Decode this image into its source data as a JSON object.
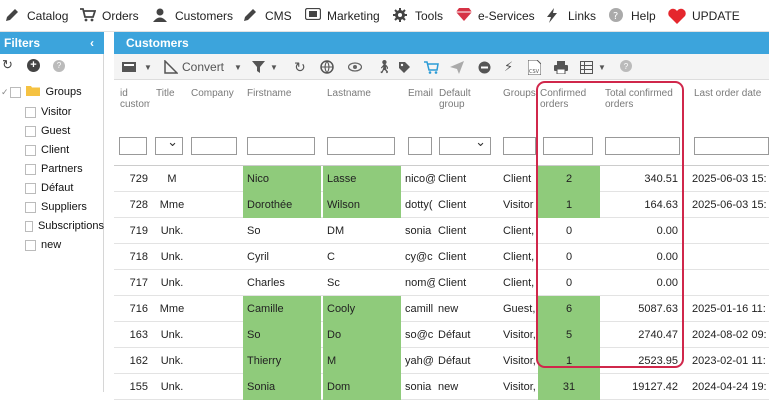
{
  "menu": [
    {
      "label": "Catalog",
      "icon": "pencil-icon"
    },
    {
      "label": "Orders",
      "icon": "cart-icon"
    },
    {
      "label": "Customers",
      "icon": "user-icon"
    },
    {
      "label": "CMS",
      "icon": "pencil-icon"
    },
    {
      "label": "Marketing",
      "icon": "ticket-icon"
    },
    {
      "label": "Tools",
      "icon": "gear-icon"
    },
    {
      "label": "e-Services",
      "icon": "diamond-icon"
    },
    {
      "label": "Links",
      "icon": "bolt-icon"
    },
    {
      "label": "Help",
      "icon": "help-icon"
    },
    {
      "label": "UPDATE",
      "icon": "heart-icon"
    }
  ],
  "filters": {
    "title": "Filters",
    "collapse_icon": "chevron-left-icon",
    "tree_root": "Groups",
    "groups": [
      "Visitor",
      "Guest",
      "Client",
      "Partners",
      "Défaut",
      "Suppliers",
      "Subscriptions",
      "new"
    ]
  },
  "grid": {
    "title": "Customers",
    "toolbar": {
      "convert_label": "Convert"
    },
    "columns": [
      {
        "key": "id",
        "label": "id custom"
      },
      {
        "key": "title",
        "label": "Title"
      },
      {
        "key": "company",
        "label": "Company"
      },
      {
        "key": "firstname",
        "label": "Firstname"
      },
      {
        "key": "lastname",
        "label": "Lastname"
      },
      {
        "key": "email",
        "label": "Email"
      },
      {
        "key": "default_group",
        "label": "Default group"
      },
      {
        "key": "groups",
        "label": "Groups"
      },
      {
        "key": "confirmed_orders",
        "label": "Confirmed orders"
      },
      {
        "key": "total_confirmed_orders",
        "label": "Total confirmed orders"
      },
      {
        "key": "last_order_date",
        "label": "Last order date"
      }
    ],
    "rows": [
      {
        "id": "729",
        "title": "M",
        "company": "",
        "firstname": "Nico",
        "lastname": "Lasse",
        "email": "nico@",
        "default_group": "Client",
        "groups": "Client",
        "confirmed_orders": "2",
        "total": "340.51",
        "last_order": "2025-06-03 15:",
        "hl_name": true,
        "hl_orders": true
      },
      {
        "id": "728",
        "title": "Mme",
        "company": "",
        "firstname": "Dorothée",
        "lastname": "Wilson",
        "email": "dotty(",
        "default_group": "Client",
        "groups": "Visitor",
        "confirmed_orders": "1",
        "total": "164.63",
        "last_order": "2025-06-03 15:",
        "hl_name": true,
        "hl_orders": true
      },
      {
        "id": "719",
        "title": "Unk.",
        "company": "",
        "firstname": "So",
        "lastname": "DM",
        "email": "sonia",
        "default_group": "Client",
        "groups": "Client,",
        "confirmed_orders": "0",
        "total": "0.00",
        "last_order": "",
        "hl_name": false,
        "hl_orders": false
      },
      {
        "id": "718",
        "title": "Unk.",
        "company": "",
        "firstname": "Cyril",
        "lastname": "C",
        "email": "cy@c",
        "default_group": "Client",
        "groups": "Client,",
        "confirmed_orders": "0",
        "total": "0.00",
        "last_order": "",
        "hl_name": false,
        "hl_orders": false
      },
      {
        "id": "717",
        "title": "Unk.",
        "company": "",
        "firstname": "Charles",
        "lastname": "Sc",
        "email": "nom@",
        "default_group": "Client",
        "groups": "Client,",
        "confirmed_orders": "0",
        "total": "0.00",
        "last_order": "",
        "hl_name": false,
        "hl_orders": false
      },
      {
        "id": "716",
        "title": "Mme",
        "company": "",
        "firstname": "Camille",
        "lastname": "Cooly",
        "email": "camill",
        "default_group": "new",
        "groups": "Guest,",
        "confirmed_orders": "6",
        "total": "5087.63",
        "last_order": "2025-01-16 11:",
        "hl_name": true,
        "hl_orders": true
      },
      {
        "id": "163",
        "title": "Unk.",
        "company": "",
        "firstname": "So",
        "lastname": "Do",
        "email": "so@c",
        "default_group": "Défaut",
        "groups": "Visitor,",
        "confirmed_orders": "5",
        "total": "2740.47",
        "last_order": "2024-08-02 09:",
        "hl_name": true,
        "hl_orders": true
      },
      {
        "id": "162",
        "title": "Unk.",
        "company": "",
        "firstname": "Thierry",
        "lastname": "M",
        "email": "yah@",
        "default_group": "Défaut",
        "groups": "Visitor,",
        "confirmed_orders": "1",
        "total": "2523.95",
        "last_order": "2023-02-01 11:",
        "hl_name": true,
        "hl_orders": true
      },
      {
        "id": "155",
        "title": "Unk.",
        "company": "",
        "firstname": "Sonia",
        "lastname": "Dom",
        "email": "sonia",
        "default_group": "new",
        "groups": "Visitor,",
        "confirmed_orders": "31",
        "total": "19127.42",
        "last_order": "2024-04-24 19:",
        "hl_name": true,
        "hl_orders": true
      }
    ]
  },
  "colors": {
    "accent": "#3ca4dc",
    "highlight_cell": "#8fcb7b",
    "annotation_border": "#d0274b"
  }
}
